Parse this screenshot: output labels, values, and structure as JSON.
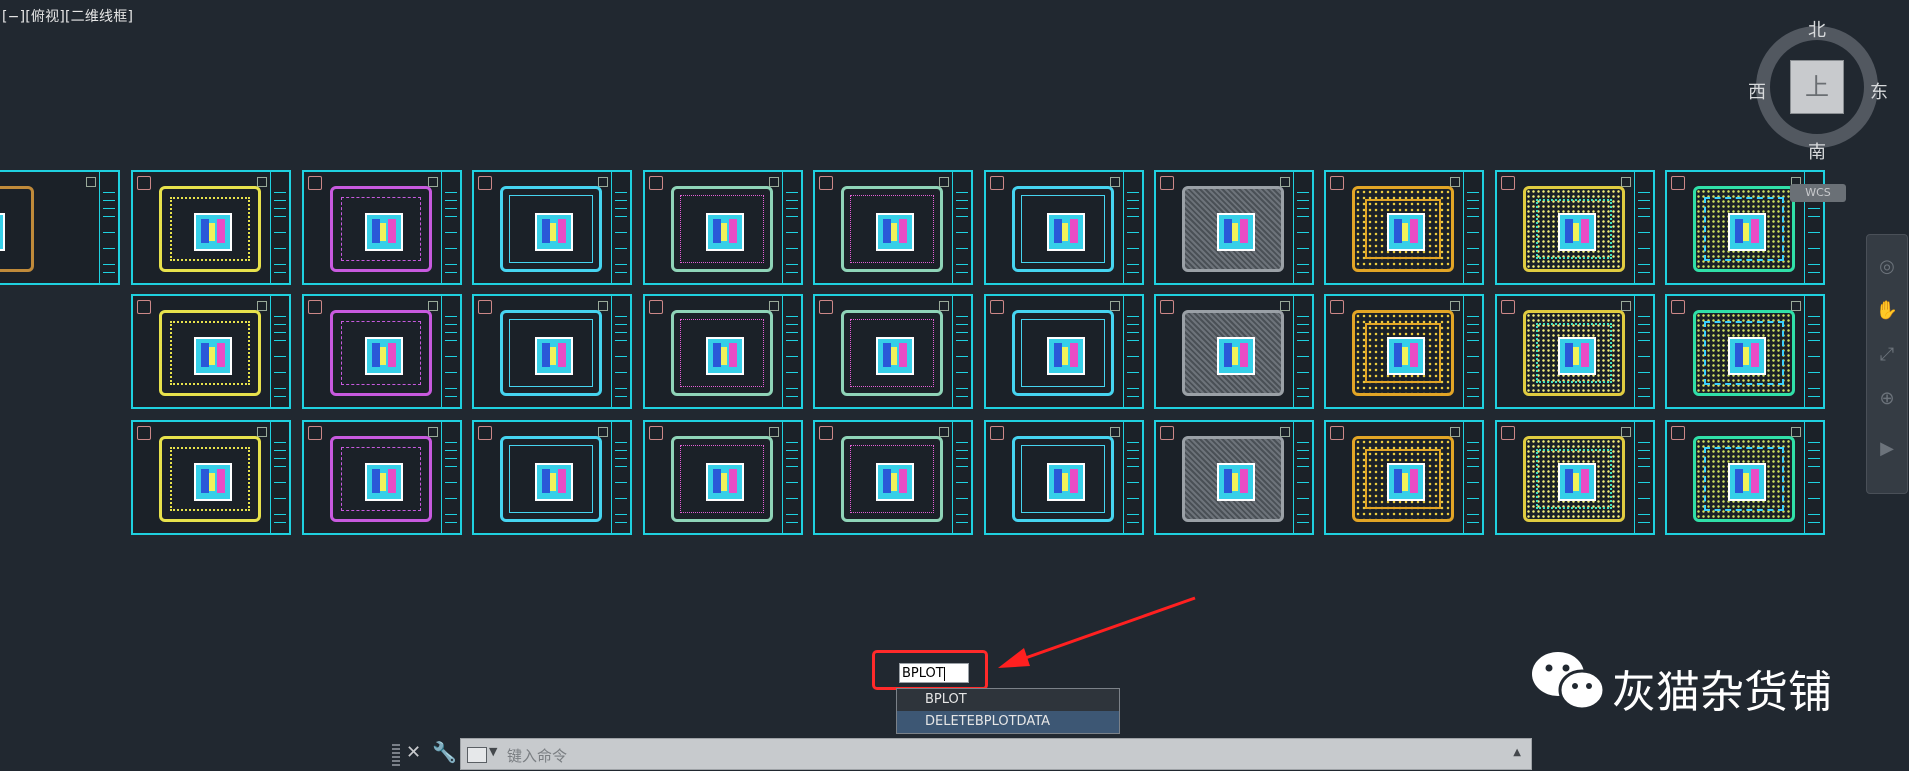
{
  "viewport": {
    "label": "[−][俯视][二维线框]"
  },
  "viewcube": {
    "north": "北",
    "south": "南",
    "west": "西",
    "east": "东",
    "face": "上",
    "wcs": "WCS"
  },
  "nav_tools": [
    "full-navigation-wheel-icon",
    "pan-icon",
    "zoom-icon",
    "orbit-icon",
    "showmotion-icon"
  ],
  "sheets": {
    "rows": [
      [
        "partial",
        "v-yellow",
        "v-purple",
        "v-cyan",
        "v-mixed",
        "v-mixed",
        "v-cyan",
        "v-gray",
        "v-gold",
        "v-dense",
        "v-teal"
      ],
      [
        "empty",
        "v-yellow",
        "v-purple",
        "v-cyan",
        "v-mixed",
        "v-mixed",
        "v-cyan",
        "v-gray",
        "v-gold",
        "v-dense",
        "v-teal"
      ],
      [
        "empty",
        "v-yellow",
        "v-purple",
        "v-cyan",
        "v-mixed",
        "v-mixed",
        "v-cyan",
        "v-gray",
        "v-gold",
        "v-dense",
        "v-teal"
      ]
    ]
  },
  "command": {
    "input_value": "BPLOT",
    "suggestions": [
      "BPLOT",
      "DELETEBPLOTDATA"
    ],
    "selected_index": 1,
    "placeholder": "键入命令",
    "highlight_color": "#ff2a2a"
  },
  "watermark": {
    "text": "灰猫杂货铺"
  }
}
